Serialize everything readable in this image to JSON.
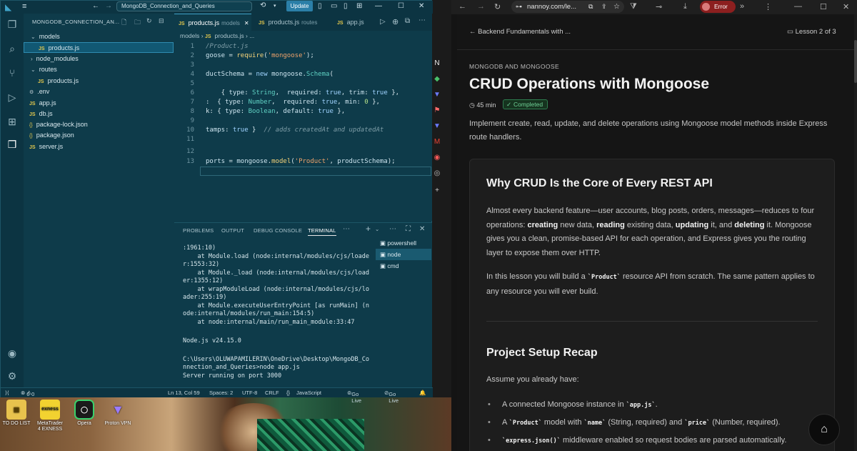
{
  "vscode": {
    "search_text": "MongoDB_Connection_and_Queries",
    "update_label": "Update",
    "explorer_title": "MONGODB_CONNECTION_AN...",
    "tree": [
      {
        "label": "models",
        "type": "folder"
      },
      {
        "label": "products.js",
        "type": "js"
      },
      {
        "label": "node_modules",
        "type": "folder"
      },
      {
        "label": "routes",
        "type": "folder"
      },
      {
        "label": "products.js",
        "type": "js"
      },
      {
        "label": ".env",
        "type": "env"
      },
      {
        "label": "app.js",
        "type": "js"
      },
      {
        "label": "db.js",
        "type": "js"
      },
      {
        "label": "package-lock.json",
        "type": "json"
      },
      {
        "label": "package.json",
        "type": "json"
      },
      {
        "label": "server.js",
        "type": "js"
      }
    ],
    "tabs": [
      {
        "label": "products.js",
        "hint": "models"
      },
      {
        "label": "products.js",
        "hint": "routes"
      },
      {
        "label": "app.js",
        "hint": ""
      }
    ],
    "breadcrumb": [
      "models",
      "products.js",
      "..."
    ],
    "line_numbers": [
      "1",
      "2",
      "3",
      "4",
      "5",
      "6",
      "7",
      "8",
      "9",
      "10",
      "11",
      "12",
      "13"
    ],
    "panel_tabs": [
      "PROBLEMS",
      "OUTPUT",
      "DEBUG CONSOLE",
      "TERMINAL"
    ],
    "terminal_lines": [
      ":1961:10)",
      "    at Module.load (node:internal/modules/cjs/loade",
      "r:1553:32)",
      "    at Module._load (node:internal/modules/cjs/load",
      "er:1355:12)",
      "    at wrapModuleLoad (node:internal/modules/cjs/lo",
      "ader:255:19)",
      "    at Module.executeUserEntryPoint [as runMain] (n",
      "ode:internal/modules/run_main:154:5)",
      "    at node:internal/main/run_main_module:33:47",
      "",
      "Node.js v24.15.0",
      "",
      "C:\\Users\\OLUWAPAMILERIN\\OneDrive\\Desktop\\MongoDB_Co",
      "nnection_and_Queries>node app.js",
      "Server running on port 3000"
    ],
    "terminals": [
      "powershell",
      "node",
      "cmd"
    ],
    "status": {
      "errors": "0",
      "warnings": "0",
      "cursor": "Ln 13, Col 59",
      "spaces": "Spaces: 2",
      "encoding": "UTF-8",
      "eol": "CRLF",
      "language": "JavaScript",
      "golive1": "Go Live",
      "golive2": "Go Live"
    }
  },
  "desktop": {
    "icons": [
      "TO DO LIST",
      "MetaTrader 4 EXNESS",
      "Opera",
      "Proton VPN"
    ],
    "exness_text": "exness"
  },
  "browser": {
    "url": "nannoy.com/le...",
    "error_label": "Error",
    "back_link": "Backend Fundamentals with ...",
    "lesson_count": "Lesson 2 of 3",
    "section_tag": "MONGODB AND MONGOOSE",
    "title": "CRUD Operations with Mongoose",
    "duration": "45 min",
    "status_badge": "Completed",
    "description": "Implement create, read, update, and delete operations using Mongoose model methods inside Express route handlers.",
    "h2_1": "Why CRUD Is the Core of Every REST API",
    "p1_start": "Almost every backend feature—user accounts, blog posts, orders, messages—reduces to four operations: ",
    "p1_creating": "creating",
    "p1_mid1": " new data, ",
    "p1_reading": "reading",
    "p1_mid2": " existing data, ",
    "p1_updating": "updating",
    "p1_mid3": " it, and ",
    "p1_deleting": "deleting",
    "p1_end": " it. Mongoose gives you a clean, promise-based API for each operation, and Express gives you the routing layer to expose them over HTTP.",
    "p2_start": "In this lesson you will build a ",
    "p2_code": "`Product`",
    "p2_end": " resource API from scratch. The same pattern applies to any resource you will ever build.",
    "h2_2": "Project Setup Recap",
    "p3": "Assume you already have:",
    "li1_start": "A connected Mongoose instance in ",
    "li1_code": "`app.js`",
    "li1_end": ".",
    "li2_start": "A ",
    "li2_code1": "`Product`",
    "li2_mid": " model with ",
    "li2_code2": "`name`",
    "li2_mid2": " (String, required) and ",
    "li2_code3": "`price`",
    "li2_end": " (Number, required).",
    "li3_code": "`express.json()`",
    "li3_end": " middleware enabled so request bodies are parsed automatically."
  }
}
